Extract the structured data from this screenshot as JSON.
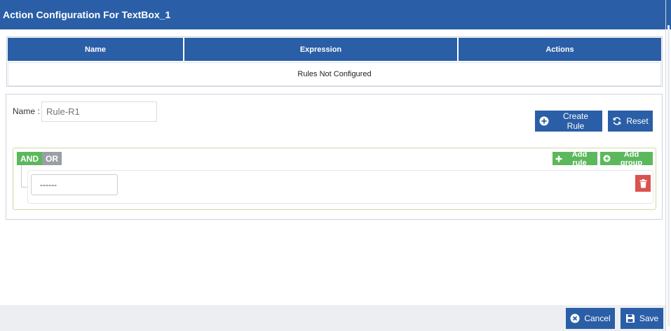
{
  "dialog": {
    "title": "Action Configuration For TextBox_1"
  },
  "rules_table": {
    "columns": [
      "Name",
      "Expression",
      "Actions"
    ],
    "empty_message": "Rules Not Configured"
  },
  "rule_editor": {
    "name_label": "Name :",
    "name_placeholder": "Rule-R1",
    "create_rule_label": "Create Rule",
    "reset_label": "Reset"
  },
  "query_builder": {
    "and_label": "AND",
    "or_label": "OR",
    "add_rule_label": "Add rule",
    "add_group_label": "Add group",
    "rules": [
      {
        "field": "------"
      }
    ]
  },
  "footer": {
    "cancel_label": "Cancel",
    "save_label": "Save"
  },
  "colors": {
    "primary": "#2a5ea6",
    "success": "#5cb85c",
    "danger": "#d9534f",
    "muted": "#9a9fa6"
  }
}
